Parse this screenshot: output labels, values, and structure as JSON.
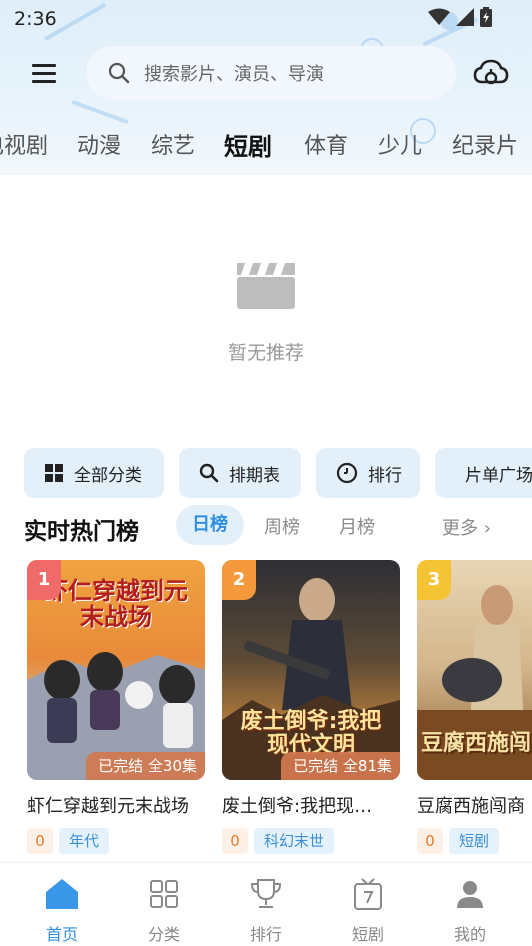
{
  "status_bar": {
    "time": "2:36"
  },
  "search": {
    "placeholder": "搜索影片、演员、导演"
  },
  "category_tabs": [
    {
      "label": "电视剧"
    },
    {
      "label": "动漫"
    },
    {
      "label": "综艺"
    },
    {
      "label": "短剧",
      "active": true
    },
    {
      "label": "体育"
    },
    {
      "label": "少儿"
    },
    {
      "label": "纪录片"
    }
  ],
  "empty_state": {
    "text": "暂无推荐"
  },
  "quick_buttons": [
    {
      "label": "全部分类",
      "icon": "grid-icon"
    },
    {
      "label": "排期表",
      "icon": "search-icon"
    },
    {
      "label": "排行",
      "icon": "clock-icon"
    },
    {
      "label": "片单广场",
      "icon": "history-icon"
    }
  ],
  "hot_section": {
    "title": "实时热门榜",
    "periods": [
      "日榜",
      "周榜",
      "月榜"
    ],
    "active_period": "日榜",
    "more": "更多 ›"
  },
  "cards": [
    {
      "rank": "1",
      "rank_color": "#f06a6a",
      "poster_text": "虾仁穿越到元末战场",
      "status": "已完结 全30集",
      "title": "虾仁穿越到元末战场",
      "score": "0",
      "tag": "年代"
    },
    {
      "rank": "2",
      "rank_color": "#f59a3c",
      "poster_text": "废土倒爷:我把现代文明",
      "status": "已完结 全81集",
      "title": "废土倒爷:我把现…",
      "score": "0",
      "tag": "科幻末世"
    },
    {
      "rank": "3",
      "rank_color": "#f4c435",
      "poster_text": "豆腐西施闯商",
      "status": "",
      "title": "豆腐西施闯商",
      "score": "0",
      "tag": "短剧"
    }
  ],
  "bottom_nav": [
    {
      "label": "首页",
      "icon": "home-icon",
      "active": true
    },
    {
      "label": "分类",
      "icon": "category-icon"
    },
    {
      "label": "排行",
      "icon": "trophy-icon"
    },
    {
      "label": "短剧",
      "icon": "tv-icon"
    },
    {
      "label": "我的",
      "icon": "user-icon"
    }
  ],
  "colors": {
    "accent": "#2f8fe0",
    "header_bg": "#e3f0fa",
    "score": "#e0802c"
  }
}
